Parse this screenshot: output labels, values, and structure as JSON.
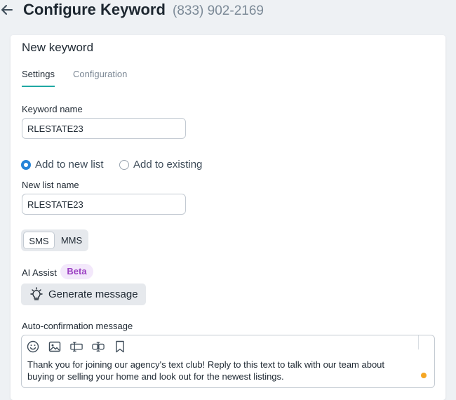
{
  "header": {
    "title": "Configure Keyword",
    "phone": "(833) 902-2169"
  },
  "card": {
    "title": "New keyword",
    "tabs": [
      {
        "label": "Settings",
        "active": true
      },
      {
        "label": "Configuration",
        "active": false
      }
    ]
  },
  "form": {
    "keyword_name_label": "Keyword name",
    "keyword_name_value": "RLESTATE23",
    "list_options": [
      {
        "label": "Add to new list",
        "checked": true
      },
      {
        "label": "Add to existing",
        "checked": false
      }
    ],
    "new_list_label": "New list name",
    "new_list_value": "RLESTATE23",
    "message_type": {
      "options": [
        "SMS",
        "MMS"
      ],
      "selected": "SMS"
    },
    "ai_assist_label": "AI Assist",
    "beta_badge": "Beta",
    "generate_label": "Generate message",
    "auto_confirmation_label": "Auto-confirmation message",
    "message_text": "Thank you for joining our agency's text club! Reply to this text to talk with our team about buying or selling your home and look out for the newest listings."
  },
  "colors": {
    "accent_teal": "#1fa8a3",
    "radio_blue": "#2684d8",
    "beta_purple": "#9b3fc2",
    "beta_bg": "#f3e8fb",
    "status_dot": "#f5a623"
  },
  "icons": {
    "back": "arrow-left-icon",
    "generate": "lightbulb-icon",
    "toolbar": [
      "emoji-icon",
      "image-icon",
      "text-field-icon",
      "link-field-icon",
      "bookmark-icon"
    ]
  }
}
